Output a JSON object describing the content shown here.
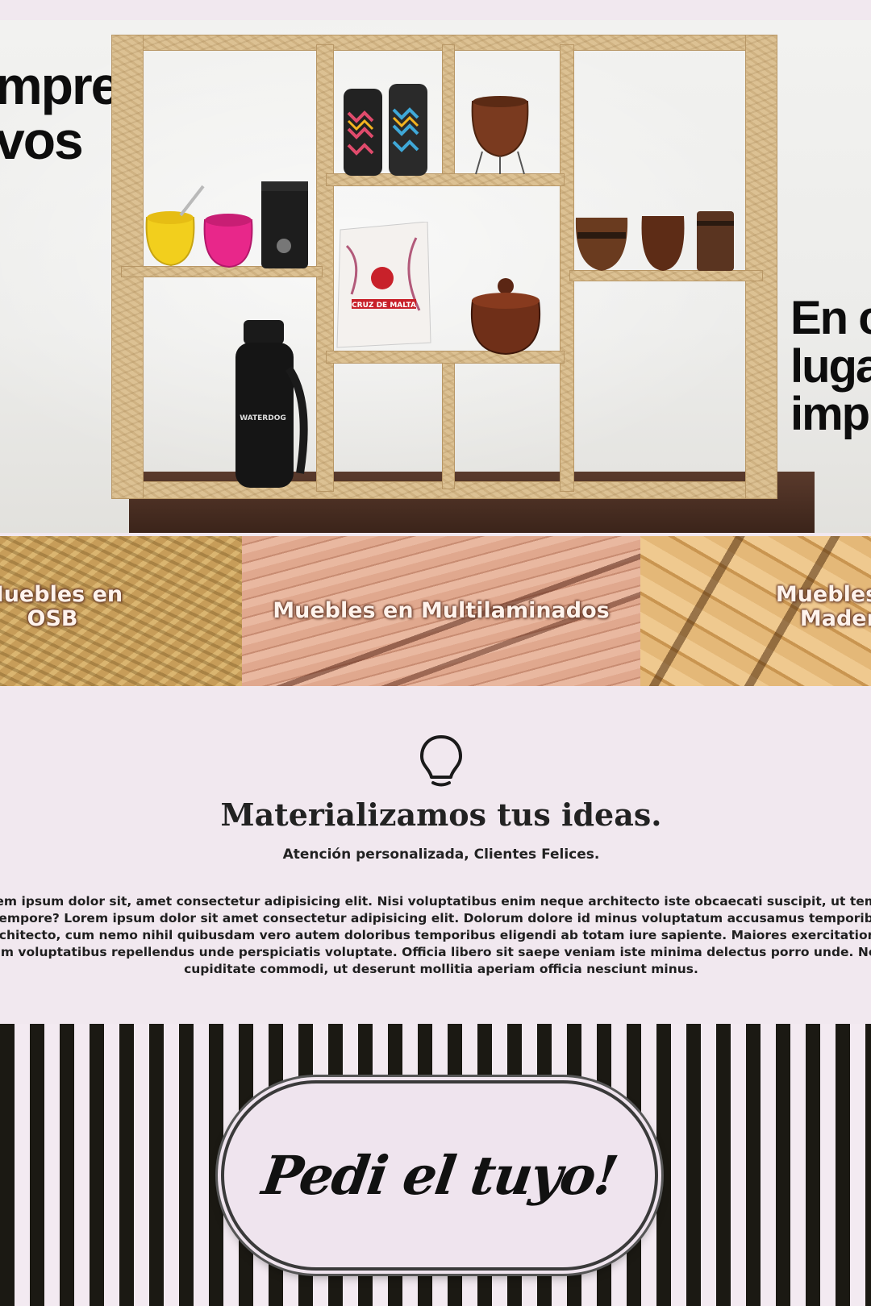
{
  "hero": {
    "text_left": "mpre\nvos",
    "text_right": "En c\nluga\nimp",
    "shelf_items": {
      "thermos_brand": "WATERDOG",
      "yerba_package": "CRUZ DE MALTA"
    }
  },
  "materials": {
    "items": [
      {
        "label": "Muebles en OSB"
      },
      {
        "label": "Muebles en Multilaminados"
      },
      {
        "label": "Muebles en Madera"
      }
    ]
  },
  "ideas": {
    "icon": "lightbulb-icon",
    "title": "Materializamos tus ideas.",
    "subtitle": "Atención personalizada, Clientes Felices.",
    "body": "Lorem ipsum dolor sit, amet consectetur adipisicing elit. Nisi voluptatibus enim neque architecto iste obcaecati suscipit, ut tempora tempore? Lorem ipsum dolor sit amet consectetur adipisicing elit. Dolorum dolore id minus voluptatum accusamus temporibus architecto, cum nemo nihil quibusdam vero autem doloribus temporibus eligendi ab totam iure sapiente. Maiores exercitationem enim voluptatibus repellendus unde perspiciatis voluptate. Officia libero sit saepe veniam iste minima delectus porro unde. Neque cupiditate commodi, ut deserunt mollitia aperiam officia nesciunt minus."
  },
  "cta": {
    "label": "Pedi el tuyo!"
  },
  "colors": {
    "background": "#f1e8ef",
    "stripe_dark": "#1b1913",
    "text_dark": "#1a1a1a"
  }
}
